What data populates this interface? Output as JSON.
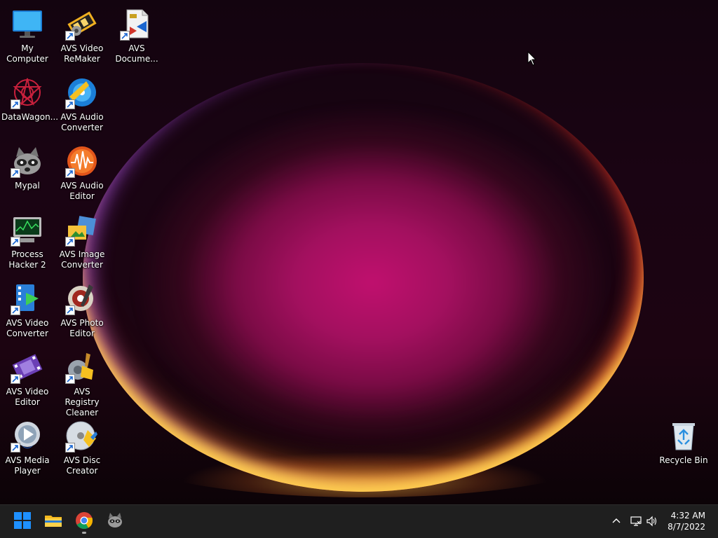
{
  "desktop": {
    "icons": [
      {
        "label": "My Computer",
        "icon": "monitor-icon"
      },
      {
        "label": "AVS Video ReMaker",
        "icon": "video-remaker-icon"
      },
      {
        "label": "AVS Docume...",
        "icon": "document-converter-icon"
      },
      {
        "label": "DataWagon...",
        "icon": "datawagon-icon"
      },
      {
        "label": "AVS Audio Converter",
        "icon": "audio-converter-icon"
      },
      {
        "label": "Mypal",
        "icon": "raccoon-icon"
      },
      {
        "label": "AVS Audio Editor",
        "icon": "audio-editor-icon"
      },
      {
        "label": "Process Hacker 2",
        "icon": "process-hacker-icon"
      },
      {
        "label": "AVS Image Converter",
        "icon": "image-converter-icon"
      },
      {
        "label": "AVS Video Converter",
        "icon": "video-converter-icon"
      },
      {
        "label": "AVS Photo Editor",
        "icon": "photo-editor-icon"
      },
      {
        "label": "AVS Video Editor",
        "icon": "video-editor-icon"
      },
      {
        "label": "AVS Registry Cleaner",
        "icon": "registry-cleaner-icon"
      },
      {
        "label": "AVS Media Player",
        "icon": "media-player-icon"
      },
      {
        "label": "AVS Disc Creator",
        "icon": "disc-creator-icon"
      },
      {
        "label": "Recycle Bin",
        "icon": "recycle-bin-icon"
      }
    ]
  },
  "taskbar": {
    "pinned": [
      {
        "name": "start",
        "icon": "windows-logo-icon"
      },
      {
        "name": "file-explorer",
        "icon": "folder-icon"
      },
      {
        "name": "chrome",
        "icon": "chrome-icon"
      },
      {
        "name": "mypal",
        "icon": "raccoon-icon"
      }
    ],
    "tray": {
      "time": "4:32 AM",
      "date": "8/7/2022"
    }
  },
  "colors": {
    "taskbar_bg": "#1f1f1f",
    "wallpaper_accent": "#c0106e",
    "windows_blue": "#1e90ff"
  }
}
